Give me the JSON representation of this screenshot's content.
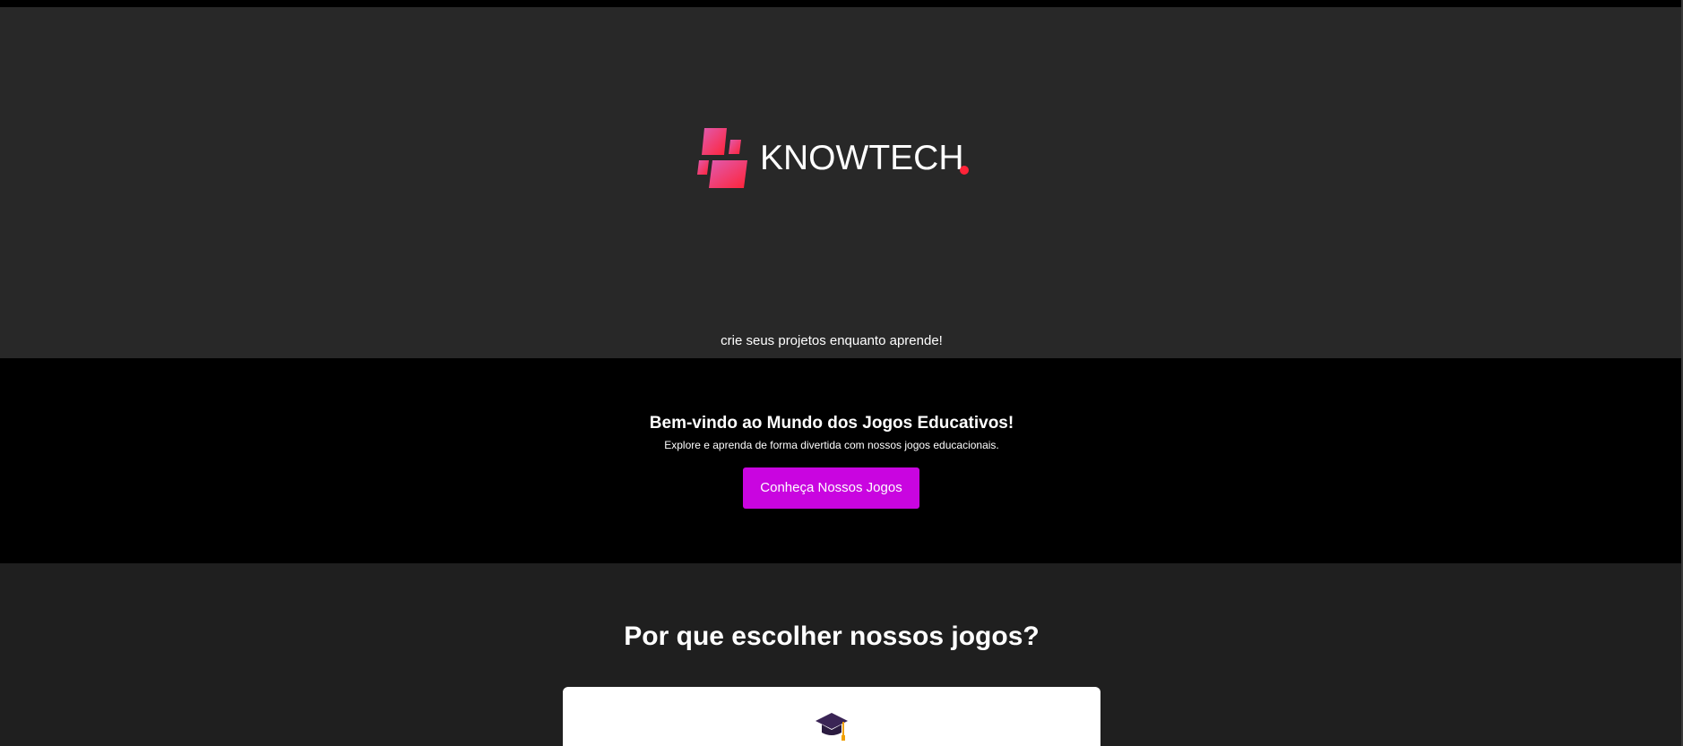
{
  "hero": {
    "logo_text": "KNOWTECH",
    "tagline": "crie seus projetos enquanto aprende!"
  },
  "welcome": {
    "title": "Bem-vindo ao Mundo dos Jogos Educativos!",
    "subtitle": "Explore e aprenda de forma divertida com nossos jogos educacionais.",
    "cta_label": "Conheça Nossos Jogos"
  },
  "why": {
    "title": "Por que escolher nossos jogos?",
    "card_icon": "graduation-cap-icon"
  },
  "colors": {
    "accent": "#c905e0",
    "logo_pink": "#ff4f9a",
    "logo_red": "#ff2338",
    "hero_bg": "#282828",
    "welcome_bg": "#000000",
    "section_bg": "#1f1f1f"
  }
}
